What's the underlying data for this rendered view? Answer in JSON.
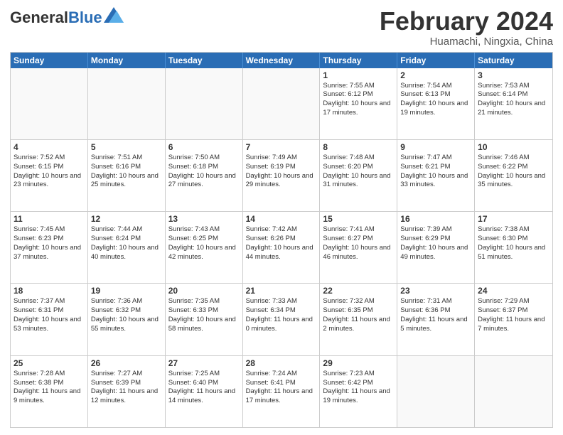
{
  "logo": {
    "general": "General",
    "blue": "Blue"
  },
  "title": {
    "month_year": "February 2024",
    "location": "Huamachi, Ningxia, China"
  },
  "weekdays": [
    "Sunday",
    "Monday",
    "Tuesday",
    "Wednesday",
    "Thursday",
    "Friday",
    "Saturday"
  ],
  "weeks": [
    [
      {
        "day": "",
        "info": ""
      },
      {
        "day": "",
        "info": ""
      },
      {
        "day": "",
        "info": ""
      },
      {
        "day": "",
        "info": ""
      },
      {
        "day": "1",
        "info": "Sunrise: 7:55 AM\nSunset: 6:12 PM\nDaylight: 10 hours and 17 minutes."
      },
      {
        "day": "2",
        "info": "Sunrise: 7:54 AM\nSunset: 6:13 PM\nDaylight: 10 hours and 19 minutes."
      },
      {
        "day": "3",
        "info": "Sunrise: 7:53 AM\nSunset: 6:14 PM\nDaylight: 10 hours and 21 minutes."
      }
    ],
    [
      {
        "day": "4",
        "info": "Sunrise: 7:52 AM\nSunset: 6:15 PM\nDaylight: 10 hours and 23 minutes."
      },
      {
        "day": "5",
        "info": "Sunrise: 7:51 AM\nSunset: 6:16 PM\nDaylight: 10 hours and 25 minutes."
      },
      {
        "day": "6",
        "info": "Sunrise: 7:50 AM\nSunset: 6:18 PM\nDaylight: 10 hours and 27 minutes."
      },
      {
        "day": "7",
        "info": "Sunrise: 7:49 AM\nSunset: 6:19 PM\nDaylight: 10 hours and 29 minutes."
      },
      {
        "day": "8",
        "info": "Sunrise: 7:48 AM\nSunset: 6:20 PM\nDaylight: 10 hours and 31 minutes."
      },
      {
        "day": "9",
        "info": "Sunrise: 7:47 AM\nSunset: 6:21 PM\nDaylight: 10 hours and 33 minutes."
      },
      {
        "day": "10",
        "info": "Sunrise: 7:46 AM\nSunset: 6:22 PM\nDaylight: 10 hours and 35 minutes."
      }
    ],
    [
      {
        "day": "11",
        "info": "Sunrise: 7:45 AM\nSunset: 6:23 PM\nDaylight: 10 hours and 37 minutes."
      },
      {
        "day": "12",
        "info": "Sunrise: 7:44 AM\nSunset: 6:24 PM\nDaylight: 10 hours and 40 minutes."
      },
      {
        "day": "13",
        "info": "Sunrise: 7:43 AM\nSunset: 6:25 PM\nDaylight: 10 hours and 42 minutes."
      },
      {
        "day": "14",
        "info": "Sunrise: 7:42 AM\nSunset: 6:26 PM\nDaylight: 10 hours and 44 minutes."
      },
      {
        "day": "15",
        "info": "Sunrise: 7:41 AM\nSunset: 6:27 PM\nDaylight: 10 hours and 46 minutes."
      },
      {
        "day": "16",
        "info": "Sunrise: 7:39 AM\nSunset: 6:29 PM\nDaylight: 10 hours and 49 minutes."
      },
      {
        "day": "17",
        "info": "Sunrise: 7:38 AM\nSunset: 6:30 PM\nDaylight: 10 hours and 51 minutes."
      }
    ],
    [
      {
        "day": "18",
        "info": "Sunrise: 7:37 AM\nSunset: 6:31 PM\nDaylight: 10 hours and 53 minutes."
      },
      {
        "day": "19",
        "info": "Sunrise: 7:36 AM\nSunset: 6:32 PM\nDaylight: 10 hours and 55 minutes."
      },
      {
        "day": "20",
        "info": "Sunrise: 7:35 AM\nSunset: 6:33 PM\nDaylight: 10 hours and 58 minutes."
      },
      {
        "day": "21",
        "info": "Sunrise: 7:33 AM\nSunset: 6:34 PM\nDaylight: 11 hours and 0 minutes."
      },
      {
        "day": "22",
        "info": "Sunrise: 7:32 AM\nSunset: 6:35 PM\nDaylight: 11 hours and 2 minutes."
      },
      {
        "day": "23",
        "info": "Sunrise: 7:31 AM\nSunset: 6:36 PM\nDaylight: 11 hours and 5 minutes."
      },
      {
        "day": "24",
        "info": "Sunrise: 7:29 AM\nSunset: 6:37 PM\nDaylight: 11 hours and 7 minutes."
      }
    ],
    [
      {
        "day": "25",
        "info": "Sunrise: 7:28 AM\nSunset: 6:38 PM\nDaylight: 11 hours and 9 minutes."
      },
      {
        "day": "26",
        "info": "Sunrise: 7:27 AM\nSunset: 6:39 PM\nDaylight: 11 hours and 12 minutes."
      },
      {
        "day": "27",
        "info": "Sunrise: 7:25 AM\nSunset: 6:40 PM\nDaylight: 11 hours and 14 minutes."
      },
      {
        "day": "28",
        "info": "Sunrise: 7:24 AM\nSunset: 6:41 PM\nDaylight: 11 hours and 17 minutes."
      },
      {
        "day": "29",
        "info": "Sunrise: 7:23 AM\nSunset: 6:42 PM\nDaylight: 11 hours and 19 minutes."
      },
      {
        "day": "",
        "info": ""
      },
      {
        "day": "",
        "info": ""
      }
    ]
  ]
}
